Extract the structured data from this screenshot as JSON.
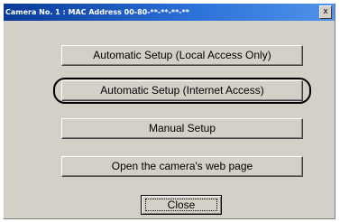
{
  "window": {
    "title": "Camera No. 1  :  MAC Address  00-80-**-**-**-**",
    "close_glyph": "x"
  },
  "buttons": {
    "auto_local": "Automatic Setup (Local Access Only)",
    "auto_internet": "Automatic Setup (Internet Access)",
    "manual": "Manual Setup",
    "web_page": "Open the camera's web page",
    "close": "Close"
  },
  "icons": {
    "close_window": "close-icon"
  }
}
